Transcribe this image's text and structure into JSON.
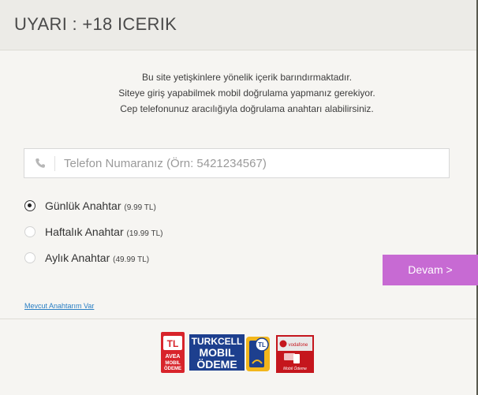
{
  "dialog": {
    "title": "UYARI : +18 ICERIK"
  },
  "intro": {
    "line1": "Bu site yetişkinlere yönelik içerik barındırmaktadır.",
    "line2": "Siteye giriş yapabilmek mobil doğrulama yapmanız gerekiyor.",
    "line3": "Cep telefonunuz aracılığıyla doğrulama anahtarı alabilirsiniz."
  },
  "phone": {
    "placeholder": "Telefon Numaranız (Örn: 5421234567)",
    "icon": "phone-icon"
  },
  "options": [
    {
      "label": "Günlük Anahtar",
      "price": "(9.99 TL)",
      "selected": true
    },
    {
      "label": "Haftalık Anahtar",
      "price": "(19.99 TL)",
      "selected": false
    },
    {
      "label": "Aylık Anahtar",
      "price": "(49.99 TL)",
      "selected": false
    }
  ],
  "devam_label": "Devam >",
  "mevcut_label": "Mevcut Anahtarım Var",
  "logos": {
    "avea_tl": "TL",
    "avea_text": [
      "AVEA",
      "MOBIL",
      "ÖDEME"
    ],
    "turkcell_text": [
      "TURKCELL",
      "MOBIL",
      "ÖDEME"
    ],
    "turkcell_tl": "TL",
    "vodafone_brand": "vodafone",
    "vodafone_text": "Mobil Ödeme"
  },
  "colors": {
    "accent": "#c76ad3",
    "link": "#2a7fc4"
  }
}
